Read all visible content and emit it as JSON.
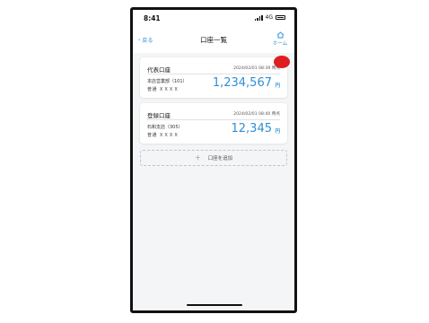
{
  "status": {
    "time": "8:41",
    "network": "4G"
  },
  "nav": {
    "back_label": "戻る",
    "title": "口座一覧",
    "home_label": "ホーム"
  },
  "accounts": [
    {
      "title": "代表口座",
      "date": "2024/02/01 08:39 時点",
      "branch": "本店営業部（101）",
      "account": "普通 ＸＸＸＸ",
      "amount": "1,234,567",
      "unit": "円"
    },
    {
      "title": "登録口座",
      "date": "2024/02/01 08:40 時点",
      "branch": "石和支店（305）",
      "account": "普通 ＸＸＸＸ",
      "amount": "12,345",
      "unit": "円"
    }
  ],
  "add_account_label": "口座を追加",
  "colors": {
    "accent": "#2f8fd6",
    "marker": "#dd1f1f",
    "background": "#f3f5f6"
  }
}
